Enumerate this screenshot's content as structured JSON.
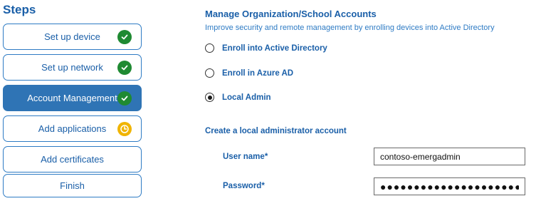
{
  "sidebar": {
    "title": "Steps",
    "steps": [
      {
        "label": "Set up device",
        "status": "complete"
      },
      {
        "label": "Set up network",
        "status": "complete"
      },
      {
        "label": "Account Management",
        "status": "complete",
        "active": true
      },
      {
        "label": "Add applications",
        "status": "pending"
      },
      {
        "label": "Add certificates",
        "status": "none"
      },
      {
        "label": "Finish",
        "status": "none"
      }
    ]
  },
  "main": {
    "heading": "Manage Organization/School Accounts",
    "subheading": "Improve security and remote management by enrolling devices into Active Directory",
    "options": [
      {
        "label": "Enroll into Active Directory",
        "selected": false
      },
      {
        "label": "Enroll in Azure AD",
        "selected": false
      },
      {
        "label": "Local Admin",
        "selected": true
      }
    ],
    "local_admin": {
      "section_title": "Create a local administrator account",
      "username_label": "User name",
      "username_value": "contoso-emergadmin",
      "password_label": "Password",
      "password_value": "●●●●●●●●●●●●●●●●●●●●●●",
      "required_marker": "*"
    }
  },
  "colors": {
    "accent": "#1a5fa8",
    "active_step": "#2f74b5",
    "complete": "#1f8a32",
    "pending": "#f0b400"
  }
}
